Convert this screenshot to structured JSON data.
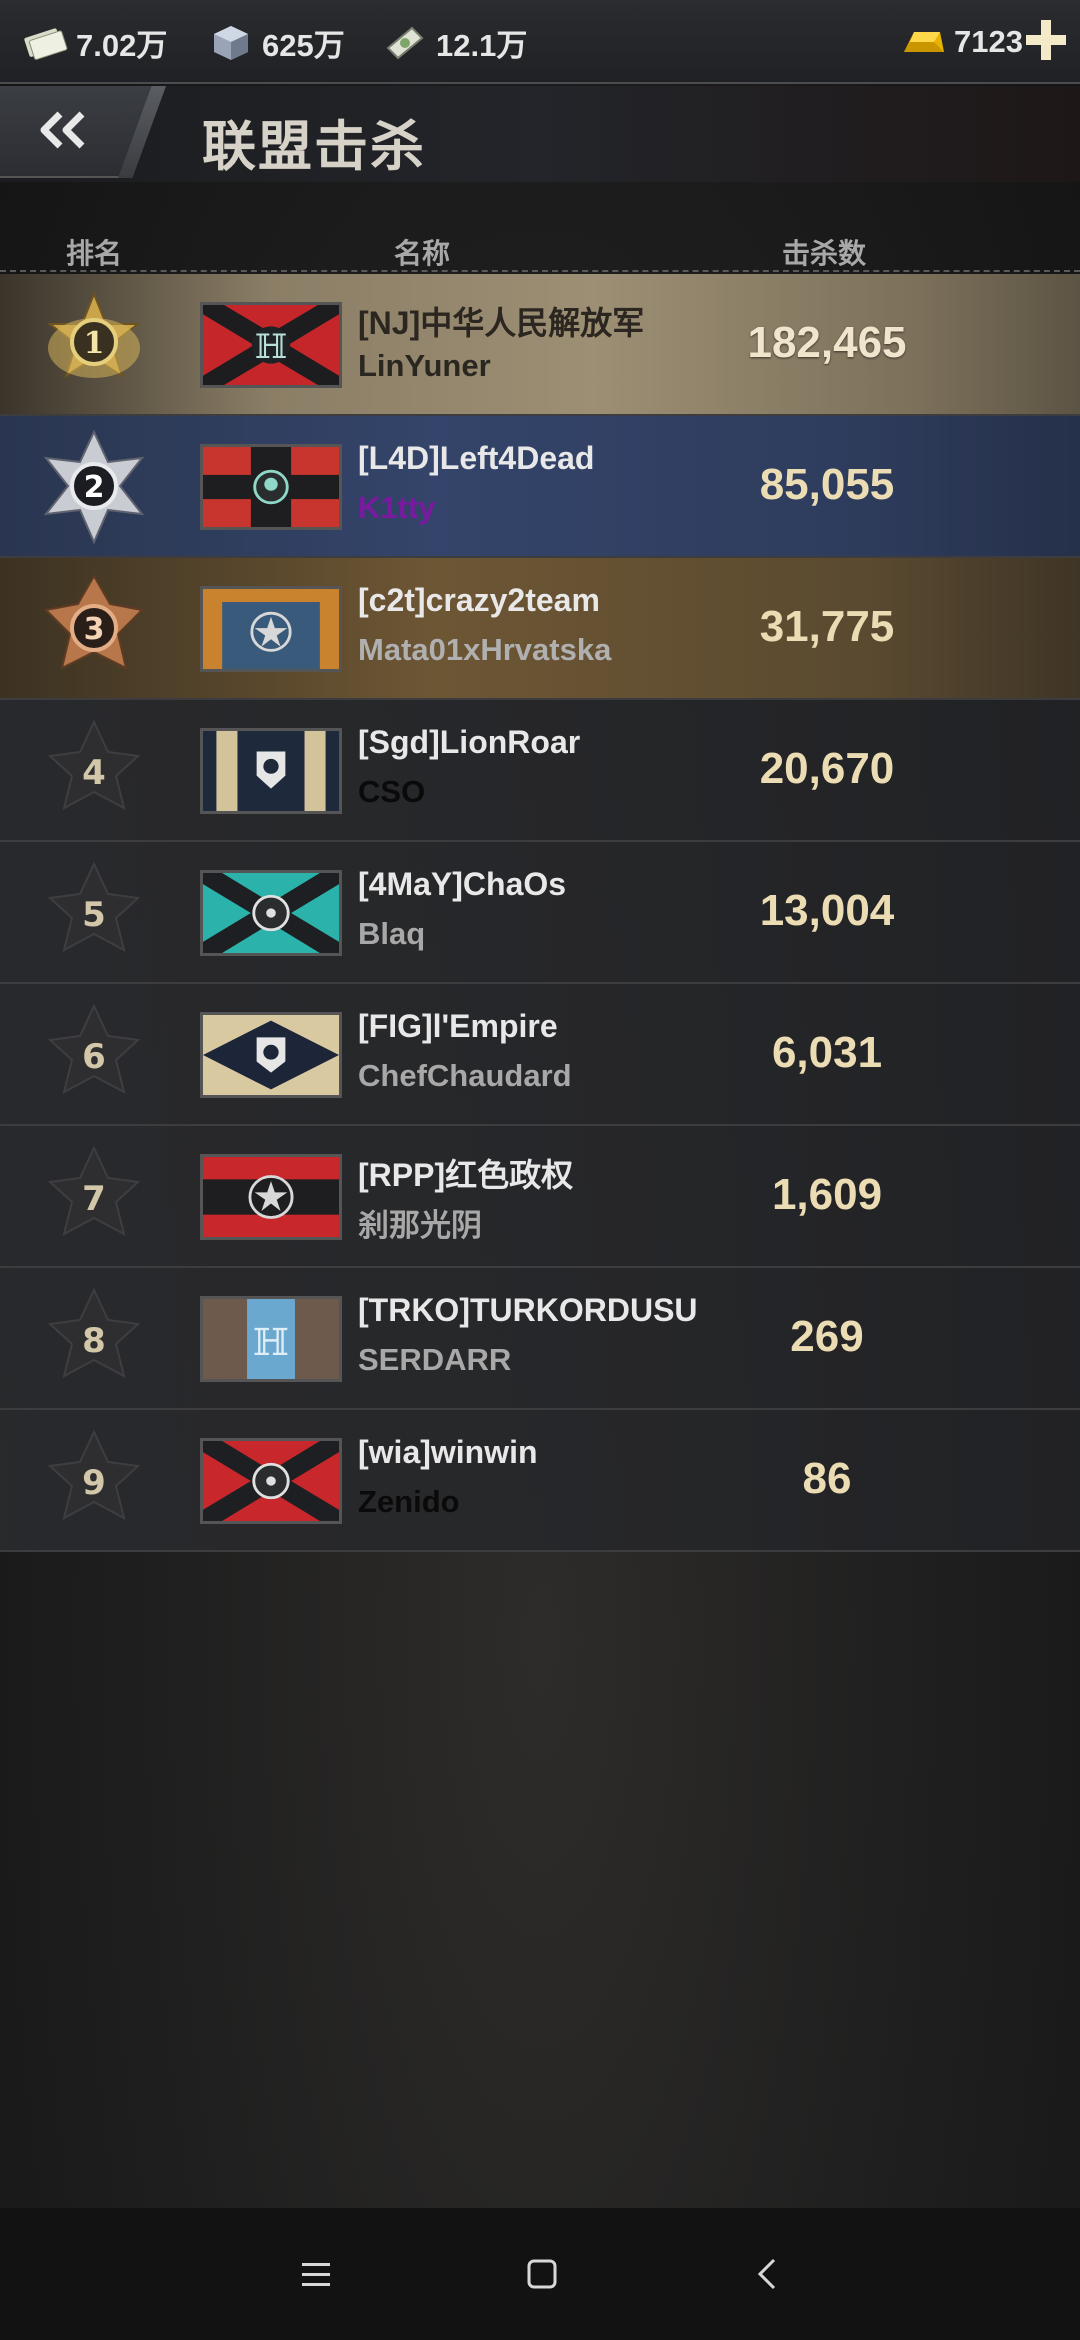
{
  "resources": [
    {
      "icon": "cash-icon",
      "value": "7.02万"
    },
    {
      "icon": "steel-icon",
      "value": "625万"
    },
    {
      "icon": "bond-icon",
      "value": "12.1万"
    }
  ],
  "gold": {
    "icon": "gold-icon",
    "value": "7123"
  },
  "header": {
    "title": "联盟击杀"
  },
  "columns": {
    "rank": "排名",
    "name": "名称",
    "kills": "击杀数"
  },
  "rows": [
    {
      "rank": "1",
      "clan": "[NJ]中华人民解放军",
      "leader": "LinYuner",
      "kills": "182,465",
      "leader_color": "#2a2620",
      "flag": "red-black-ti"
    },
    {
      "rank": "2",
      "clan": "[L4D]Left4Dead",
      "leader": "K1tty",
      "kills": "85,055",
      "leader_color": "#7a1aa0",
      "flag": "red-black-skull"
    },
    {
      "rank": "3",
      "clan": "[c2t]crazy2team",
      "leader": "Mata01xHrvatska",
      "kills": "31,775",
      "leader_color": "#b0b0b0",
      "flag": "blue-orange-star"
    },
    {
      "rank": "4",
      "clan": "[Sgd]LionRoar",
      "leader": "CSO",
      "kills": "20,670",
      "leader_color": "#0a0a0a",
      "flag": "navy-tan-lion"
    },
    {
      "rank": "5",
      "clan": "[4MaY]ChaOs",
      "leader": "Blaq",
      "kills": "13,004",
      "leader_color": "#a8a8a8",
      "flag": "teal-black-nuke"
    },
    {
      "rank": "6",
      "clan": "[FIG]l'Empire",
      "leader": "ChefChaudard",
      "kills": "6,031",
      "leader_color": "#a8a8a8",
      "flag": "tan-navy-lion"
    },
    {
      "rank": "7",
      "clan": "[RPP]红色政权",
      "leader": "刹那光阴",
      "kills": "1,609",
      "leader_color": "#a8a8a8",
      "flag": "red-black-star"
    },
    {
      "rank": "8",
      "clan": "[TRKO]TURKORDUSU",
      "leader": "SERDARR",
      "kills": "269",
      "leader_color": "#a8a8a8",
      "flag": "brown-blue-ti"
    },
    {
      "rank": "9",
      "clan": "[wia]winwin",
      "leader": "Zenido",
      "kills": "86",
      "leader_color": "#0a0a0a",
      "flag": "red-black-nuke"
    }
  ],
  "nav": [
    {
      "icon": "menu-icon"
    },
    {
      "icon": "home-icon"
    },
    {
      "icon": "back-icon"
    }
  ]
}
